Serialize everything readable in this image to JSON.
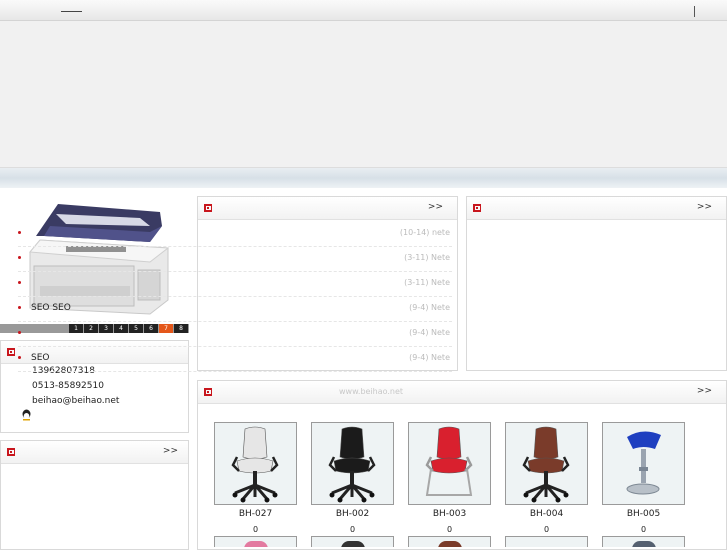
{
  "panels": {
    "news_more": ">>",
    "right_more": ">>",
    "products_more": ">>",
    "left_more": ">>",
    "products_watermark": "www.beihao.net"
  },
  "slideshow": {
    "pages": [
      "1",
      "2",
      "3",
      "4",
      "5",
      "6",
      "7",
      "8"
    ],
    "active": 6
  },
  "contact": {
    "phone": "13962807318",
    "tel": "0513-85892510",
    "email": "beihao@beihao.net"
  },
  "news": [
    {
      "title": "",
      "date": "(10-14) nete"
    },
    {
      "title": "",
      "date": "(3-11) Nete"
    },
    {
      "title": "",
      "date": "(3-11) Nete"
    },
    {
      "title": "SEO SEO",
      "date": "(9-4) Nete"
    },
    {
      "title": "",
      "date": "(9-4) Nete"
    },
    {
      "title": "SEO",
      "date": "(9-4) Nete"
    }
  ],
  "products": [
    {
      "name": "BH-027",
      "count": "0",
      "color": "#e6e6e6"
    },
    {
      "name": "BH-002",
      "count": "0",
      "color": "#1b1b1b"
    },
    {
      "name": "BH-003",
      "count": "0",
      "color": "#d9202e"
    },
    {
      "name": "BH-004",
      "count": "0",
      "color": "#7a3b2a"
    },
    {
      "name": "BH-005",
      "count": "0",
      "color": "#1e3fc0"
    }
  ],
  "colors": {
    "accent": "#c8161d",
    "pager_active": "#e4571a"
  }
}
